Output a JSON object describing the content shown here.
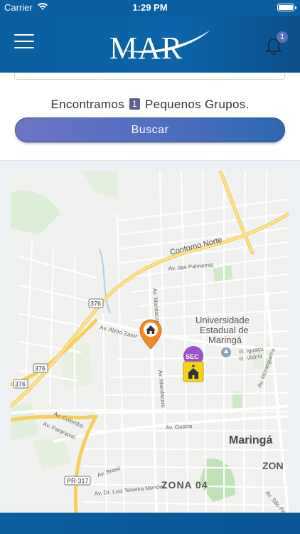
{
  "status_bar": {
    "carrier": "Carrier",
    "time": "1:29 PM"
  },
  "header": {
    "logo_text": "MAR",
    "notification_count": "1"
  },
  "search": {
    "found_prefix": "Encontramos",
    "found_count": "1",
    "found_suffix": "Pequenos Grupos.",
    "button_label": "Buscar"
  },
  "map": {
    "labels": {
      "contorno_norte": "Contorno Norte",
      "av_palmeiras": "Av. das Palmeiras",
      "av_mandacaru": "Av. Mandacaru",
      "av_mandacaru2": "Av. Mandacaru",
      "av_alziro": "Av. Alziro Zarur",
      "universidade": "Universidade",
      "estadual": "Estadual de",
      "maringa_uni": "Maringá",
      "r_iguacu": "R. Iguaçu",
      "r_vitoria": "R. Vitória",
      "av_morangueira": "Av. Morangueira",
      "road_376a": "376",
      "road_376b": "376",
      "road_376c": "376",
      "av_colombo": "Av. Colombo",
      "av_paranavai": "Av. Paranavaí",
      "av_guaira": "Av. Guaíra",
      "maringa": "Maringá",
      "zona_partial": "ZON",
      "pr317": "PR-317",
      "av_brasil": "Av. Brasil",
      "av_luiz": "Av. Dr. Luiz Teixeira Mendes",
      "zona04": "ZONA 04",
      "av_sao_paulo": "Av. São Pa"
    },
    "church_badge": "SEC"
  },
  "colors": {
    "primary": "#0a5fa0",
    "accent": "#5b6fb5",
    "pin": "#f08a24",
    "road": "#f5d874"
  }
}
